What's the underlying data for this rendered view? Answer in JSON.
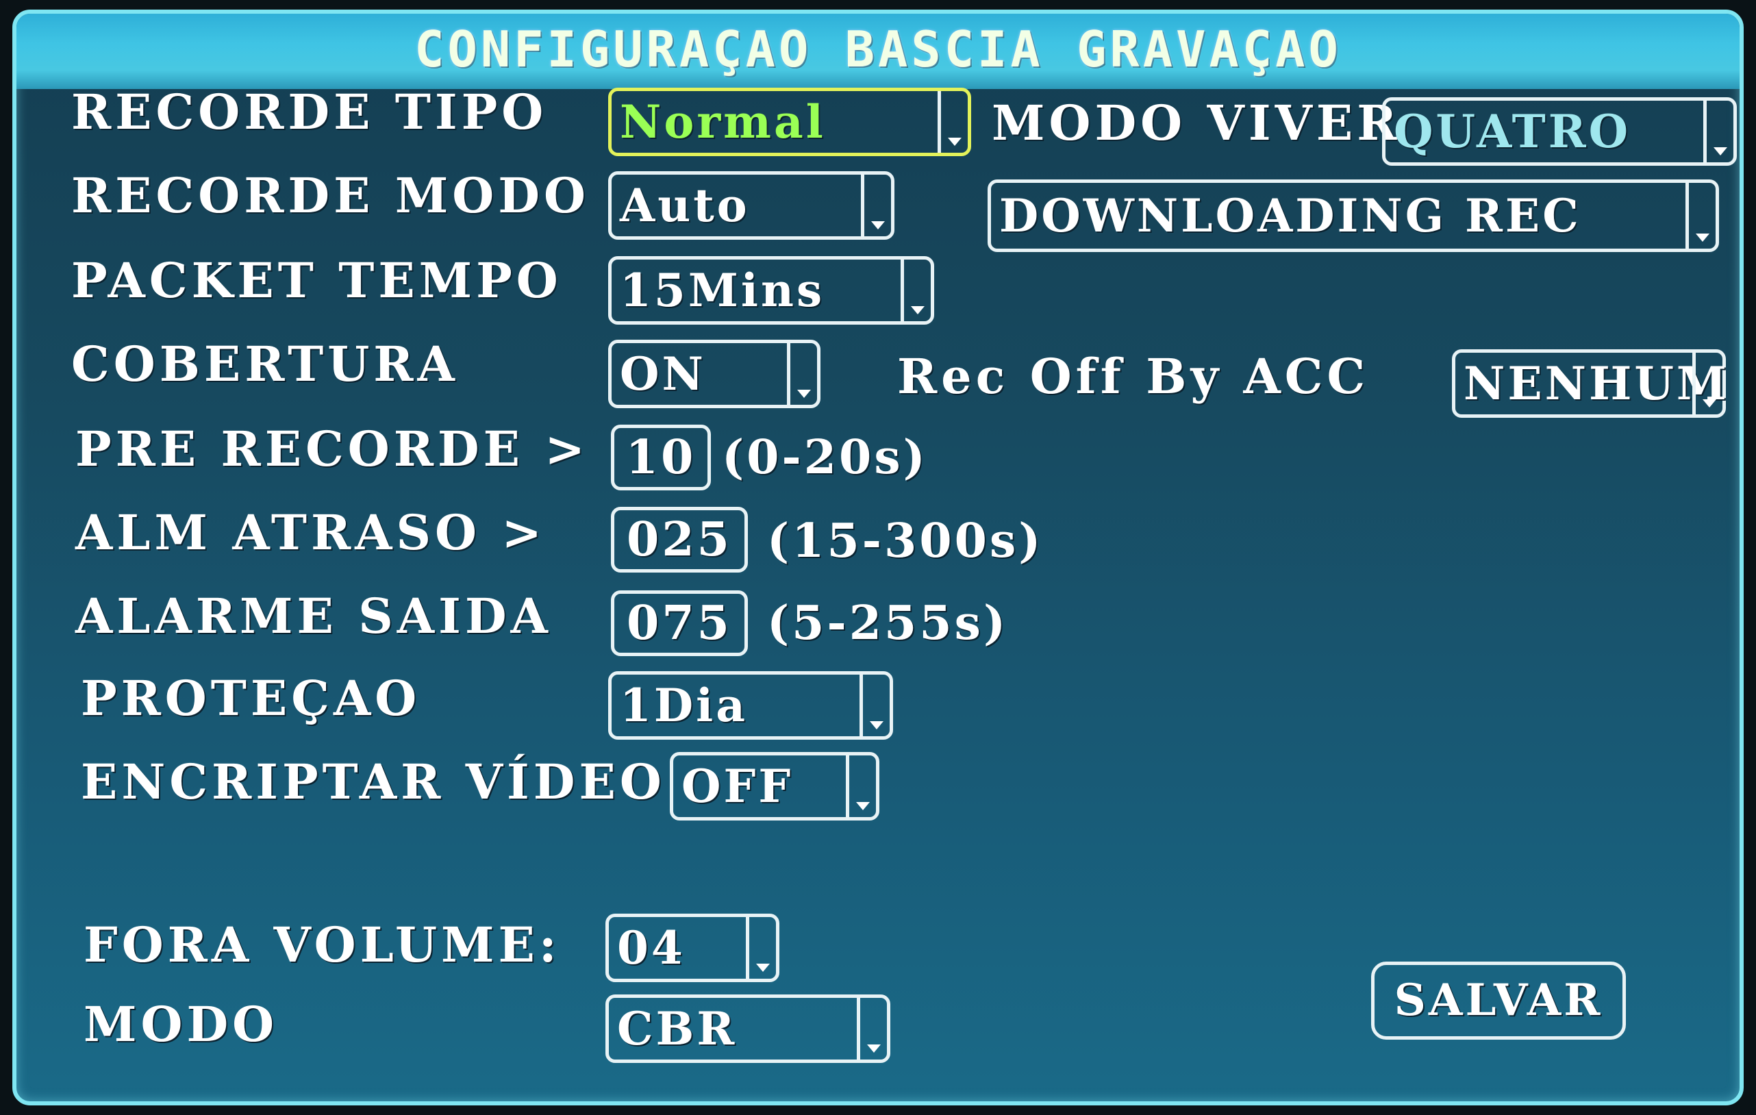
{
  "title": "CONFIGURAÇAO BASCIA GRAVAÇAO",
  "fields": {
    "record_type": {
      "label": "RECORDE TIPO",
      "value": "Normal"
    },
    "live_mode": {
      "label": "MODO VIVER",
      "value": "QUATRO"
    },
    "record_mode": {
      "label": "RECORDE MODO",
      "value": "Auto"
    },
    "downloading": {
      "value": "DOWNLOADING REC"
    },
    "packet_time": {
      "label": "PACKET TEMPO",
      "value": "15Mins"
    },
    "overwrite": {
      "label": "COBERTURA",
      "value": "ON"
    },
    "rec_off_acc": {
      "label": "Rec Off By ACC",
      "value": "NENHUM"
    },
    "pre_record": {
      "label": "PRE RECORDE >",
      "value": "10",
      "range": "(0-20s)"
    },
    "alarm_delay": {
      "label": "ALM ATRASO >",
      "value": "025",
      "range": "(15-300s)"
    },
    "alarm_out": {
      "label": "ALARME SAIDA",
      "value": "075",
      "range": "(5-255s)"
    },
    "protection": {
      "label": "PROTEÇAO",
      "value": "1Dia"
    },
    "encrypt_video": {
      "label": "ENCRIPTAR VÍDEO",
      "value": "OFF"
    },
    "out_volume": {
      "label": "FORA VOLUME:",
      "value": "04"
    },
    "mode": {
      "label": "MODO",
      "value": "CBR"
    }
  },
  "buttons": {
    "save": "SALVAR"
  },
  "colors": {
    "focus_border": "#e3f25a",
    "focus_text": "#9aff55",
    "frame": "#7fe6f2"
  }
}
